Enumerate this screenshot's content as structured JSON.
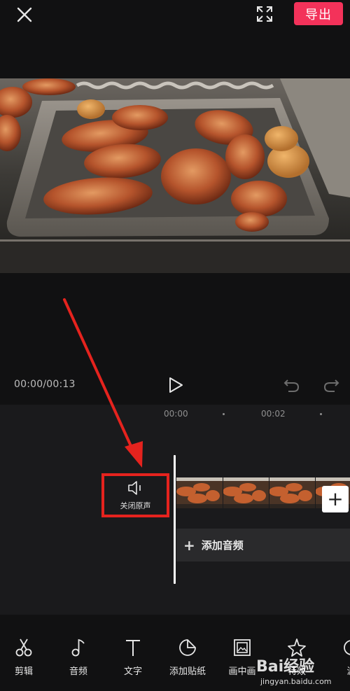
{
  "header": {
    "export_label": "导出"
  },
  "player": {
    "timecode": "00:00/00:13"
  },
  "timeline": {
    "ruler": [
      "00:00",
      "00:02"
    ],
    "mute_label": "关闭原声",
    "add_audio_label": "添加音频",
    "add_clip_symbol": "+"
  },
  "toolbar": {
    "items": [
      {
        "label": "剪辑",
        "icon": "scissors-icon"
      },
      {
        "label": "音频",
        "icon": "music-note-icon"
      },
      {
        "label": "文字",
        "icon": "text-icon"
      },
      {
        "label": "添加贴纸",
        "icon": "sticker-icon"
      },
      {
        "label": "画中画",
        "icon": "picture-in-picture-icon"
      },
      {
        "label": "特效",
        "icon": "sparkle-icon"
      },
      {
        "label": "滤",
        "icon": "filter-icon"
      }
    ]
  },
  "watermark": {
    "brand": "Bai经验",
    "url": "jingyan.baidu.com"
  },
  "colors": {
    "accent": "#f3325a",
    "highlight_box": "#e5231e",
    "background": "#111112"
  }
}
